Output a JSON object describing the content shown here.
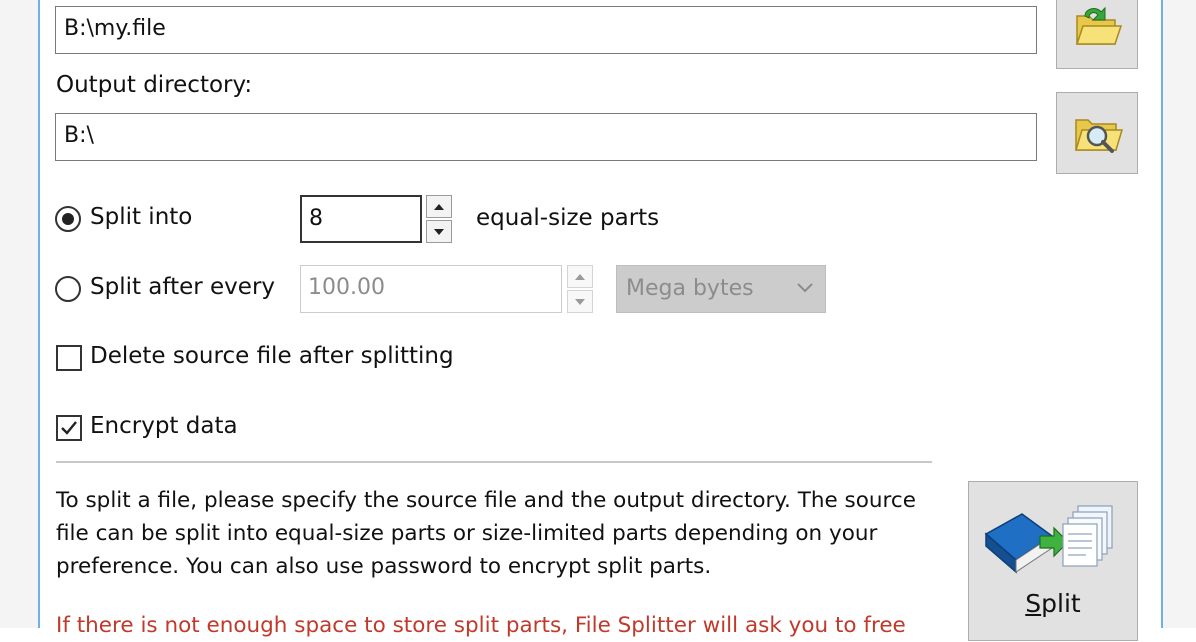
{
  "source_file": {
    "value": "B:\\my.file",
    "browse_icon": "open-folder-arrow-icon"
  },
  "output_directory": {
    "label": "Output directory:",
    "value": "B:\\",
    "browse_icon": "folder-search-icon"
  },
  "split_into": {
    "label": "Split into",
    "checked": true,
    "value": "8",
    "suffix": "equal-size parts"
  },
  "split_after_every": {
    "label": "Split after every",
    "checked": false,
    "value": "100.00",
    "unit_selected": "Mega bytes",
    "disabled": true
  },
  "delete_source": {
    "label": "Delete source file after splitting",
    "checked": false
  },
  "encrypt": {
    "label": "Encrypt data",
    "checked": true
  },
  "help": {
    "paragraph1": "To split a file, please specify the source file and the output directory. The source file can be split into equal-size parts or size-limited parts depending on your preference. You can also use password to encrypt split parts.",
    "paragraph2_partial": "If there is not enough space to store split parts, File Splitter will ask you to free"
  },
  "split_button": {
    "label": "Split",
    "icon": "book-to-pages-icon"
  },
  "colors": {
    "window_border": "#6fb0e6",
    "button_face": "#e1e1e1",
    "disabled_field": "#cccccc"
  }
}
